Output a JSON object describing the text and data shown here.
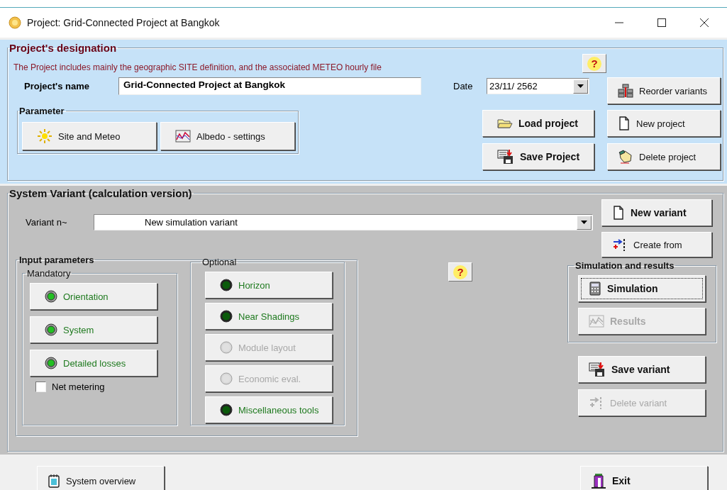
{
  "window": {
    "title": "Project:  Grid-Connected Project at Bangkok"
  },
  "designation": {
    "title": "Project's designation",
    "description": "The Project includes mainly the geographic SITE definition, and the associated  METEO  hourly file",
    "help": "?",
    "name_label": "Project's name",
    "name_value": "Grid-Connected Project at Bangkok",
    "date_label": "Date",
    "date_value": "23/11/ 2562",
    "reorder": {
      "label": "Reorder variants",
      "kind": "reorder",
      "bold": false,
      "disabled": false
    },
    "parameter": {
      "title": "Parameter",
      "buttons": [
        {
          "label": "Site and Meteo",
          "kind": "sun",
          "bold": false,
          "disabled": false
        },
        {
          "label": "Albedo - settings",
          "kind": "chart",
          "bold": false,
          "disabled": false
        }
      ]
    },
    "project_buttons": [
      {
        "label": "Load project",
        "kind": "folder",
        "bold": true,
        "disabled": false
      },
      {
        "label": "New project",
        "kind": "page",
        "bold": false,
        "disabled": false
      },
      {
        "label": "Save Project",
        "kind": "save",
        "bold": true,
        "disabled": false
      },
      {
        "label": "Delete project",
        "kind": "hand",
        "bold": false,
        "disabled": false
      }
    ]
  },
  "variant": {
    "title": "System Variant (calculation version)",
    "variant_label": "Variant n~",
    "variant_value": "New simulation variant",
    "variant_buttons": [
      {
        "label": "New variant",
        "kind": "page",
        "bold": true,
        "disabled": false
      },
      {
        "label": "Create from",
        "kind": "arrows",
        "bold": false,
        "disabled": false
      }
    ],
    "input_parameters": {
      "title": "Input parameters",
      "mandatory": {
        "title": "Mandatory",
        "items": [
          {
            "label": "Orientation",
            "disabled": false
          },
          {
            "label": "System",
            "disabled": false
          },
          {
            "label": "Detailed losses",
            "disabled": false
          }
        ]
      },
      "net_metering": {
        "label": "Net metering",
        "checked": false
      },
      "optional": {
        "title": "Optional",
        "items": [
          {
            "label": "Horizon",
            "disabled": false
          },
          {
            "label": "Near Shadings",
            "disabled": false
          },
          {
            "label": "Module layout",
            "disabled": true
          },
          {
            "label": "Economic eval.",
            "disabled": true
          },
          {
            "label": "Miscellaneous tools",
            "disabled": false
          }
        ]
      }
    },
    "help": "?",
    "simulation": {
      "title": "Simulation and results",
      "buttons": [
        {
          "label": "Simulation",
          "kind": "calculator",
          "bold": true,
          "disabled": false,
          "focused": true
        },
        {
          "label": "Results",
          "kind": "results",
          "bold": true,
          "disabled": true,
          "focused": false
        }
      ]
    },
    "save_buttons": [
      {
        "label": "Save variant",
        "kind": "save",
        "bold": true,
        "disabled": false
      },
      {
        "label": "Delete variant",
        "kind": "arrows",
        "bold": false,
        "disabled": true
      }
    ]
  },
  "footer": {
    "buttons": [
      {
        "label": "System overview",
        "kind": "notebook",
        "bold": false,
        "disabled": false
      },
      {
        "label": "Exit",
        "kind": "exit",
        "bold": true,
        "disabled": false
      }
    ]
  }
}
